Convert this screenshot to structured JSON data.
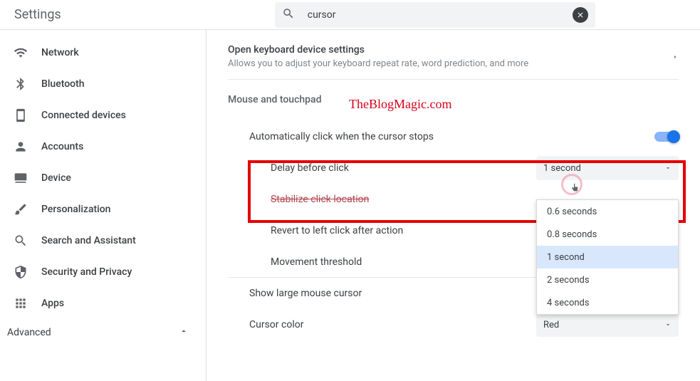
{
  "header": {
    "title": "Settings",
    "search_value": "cursor"
  },
  "sidebar": {
    "items": [
      {
        "label": "Network"
      },
      {
        "label": "Bluetooth"
      },
      {
        "label": "Connected devices"
      },
      {
        "label": "Accounts"
      },
      {
        "label": "Device"
      },
      {
        "label": "Personalization"
      },
      {
        "label": "Search and Assistant"
      },
      {
        "label": "Security and Privacy"
      },
      {
        "label": "Apps"
      }
    ],
    "advanced_label": "Advanced"
  },
  "main": {
    "keyboard": {
      "title": "Open keyboard device settings",
      "desc": "Allows you to adjust your keyboard repeat rate, word prediction, and more"
    },
    "section_title": "Mouse and touchpad",
    "autoclick_label": "Automatically click when the cursor stops",
    "delay_label": "Delay before click",
    "delay_value": "1 second",
    "delay_options": [
      "0.6 seconds",
      "0.8 seconds",
      "1 second",
      "2 seconds",
      "4 seconds"
    ],
    "stabilize_label": "Stabilize click location",
    "revert_label": "Revert to left click after action",
    "threshold_label": "Movement threshold",
    "large_cursor_label": "Show large mouse cursor",
    "cursor_color_label": "Cursor color",
    "cursor_color_value": "Red"
  },
  "watermark": "TheBlogMagic.com"
}
